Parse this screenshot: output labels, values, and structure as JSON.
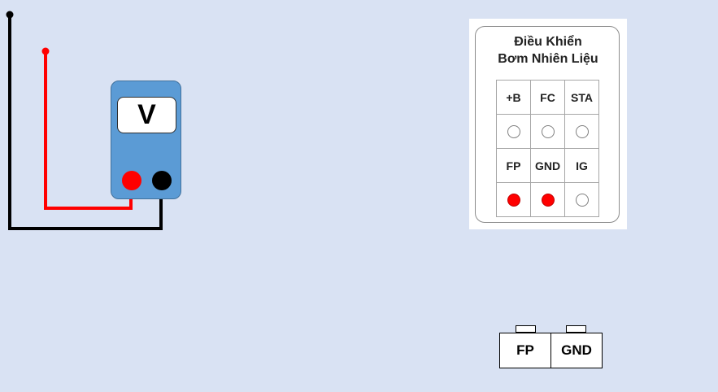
{
  "colors": {
    "background": "#d9e2f3",
    "meter_body": "#5b9bd5",
    "probe_red": "#ff0000",
    "probe_black": "#000000",
    "pin_active": "#ff0000"
  },
  "meter": {
    "display_label": "V"
  },
  "ecu_panel": {
    "title_line1": "Điều Khiển",
    "title_line2": "Bơm Nhiên Liệu",
    "pins": [
      {
        "label": "+B",
        "active": false
      },
      {
        "label": "FC",
        "active": false
      },
      {
        "label": "STA",
        "active": false
      },
      {
        "label": "FP",
        "active": true
      },
      {
        "label": "GND",
        "active": true
      },
      {
        "label": "IG",
        "active": false
      }
    ]
  },
  "connector": {
    "left_label": "FP",
    "right_label": "GND"
  }
}
